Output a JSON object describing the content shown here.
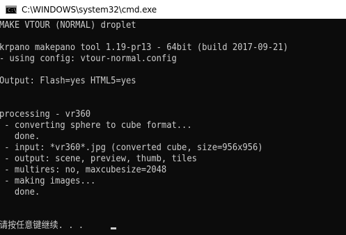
{
  "window": {
    "title": "C:\\WINDOWS\\system32\\cmd.exe",
    "icon": "cmd-icon",
    "icon_prompt": "C:\\"
  },
  "console": {
    "lines": [
      "MAKE VTOUR (NORMAL) droplet",
      "",
      "krpano makepano tool 1.19-pr13 - 64bit (build 2017-09-21)",
      "- using config: vtour-normal.config",
      "",
      "Output: Flash=yes HTML5=yes",
      "",
      "",
      "processing - vr360",
      " - converting sphere to cube format...",
      "   done.",
      " - input: *vr360*.jpg (converted cube, size=956x956)",
      " - output: scene, preview, thumb, tiles",
      " - multires: no, maxcubesize=2048",
      " - making images...",
      "   done.",
      "",
      "请按任意键继续. . ."
    ],
    "cursor": "_"
  },
  "colors": {
    "console_bg": "#0c0c0c",
    "console_text": "#cccccc",
    "titlebar_bg": "#ffffff"
  }
}
